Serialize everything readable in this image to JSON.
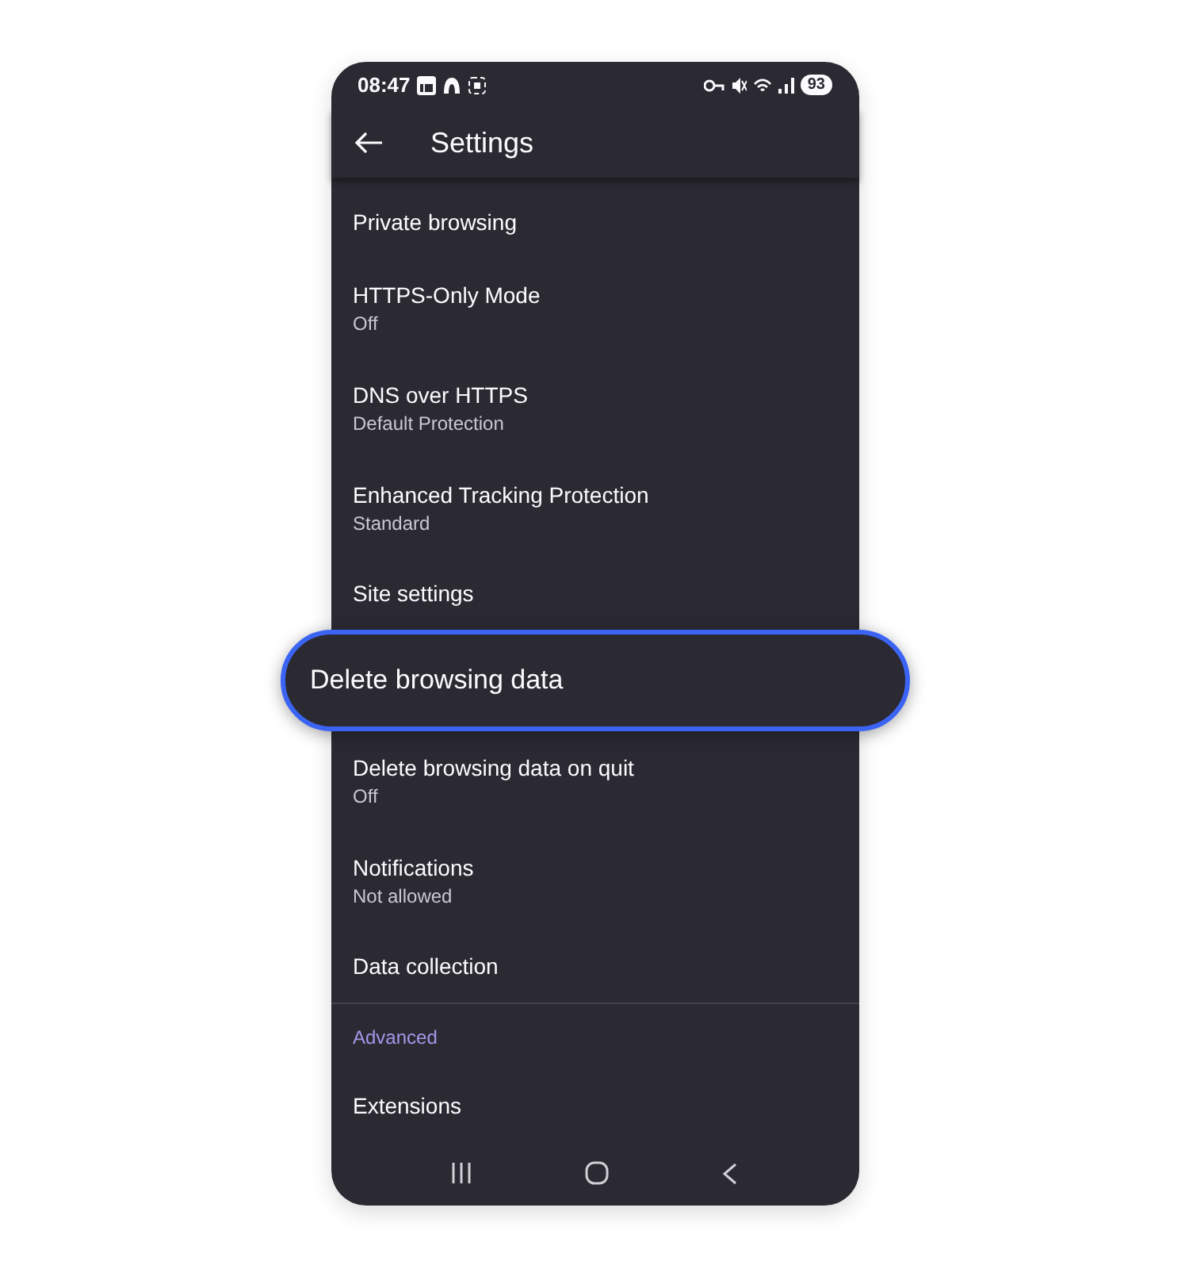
{
  "status_bar": {
    "time": "08:47",
    "battery": "93"
  },
  "toolbar": {
    "title": "Settings"
  },
  "items": [
    {
      "kind": "setting",
      "title": "Private browsing",
      "highlighted": false
    },
    {
      "kind": "setting",
      "title": "HTTPS-Only Mode",
      "subtitle": "Off",
      "highlighted": false
    },
    {
      "kind": "setting",
      "title": "DNS over HTTPS",
      "subtitle": "Default Protection",
      "highlighted": false
    },
    {
      "kind": "setting",
      "title": "Enhanced Tracking Protection",
      "subtitle": "Standard",
      "highlighted": false
    },
    {
      "kind": "setting",
      "title": "Site settings",
      "highlighted": false
    },
    {
      "kind": "setting",
      "title": "Delete browsing data",
      "highlighted": true
    },
    {
      "kind": "setting",
      "title": "Delete browsing data on quit",
      "subtitle": "Off",
      "highlighted": false
    },
    {
      "kind": "setting",
      "title": "Notifications",
      "subtitle": "Not allowed",
      "highlighted": false
    },
    {
      "kind": "setting",
      "title": "Data collection",
      "highlighted": false
    },
    {
      "kind": "section",
      "title": "Advanced"
    },
    {
      "kind": "setting",
      "title": "Extensions",
      "highlighted": false
    }
  ]
}
